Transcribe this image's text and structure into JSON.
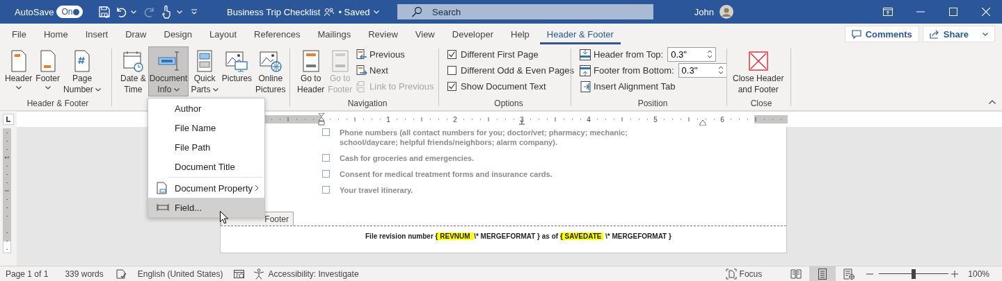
{
  "title_bar": {
    "autosave_label": "AutoSave",
    "autosave": {
      "label": "On",
      "on": true
    },
    "document_title": "Business Trip Checklist",
    "save_status": "• Saved",
    "search": {
      "placeholder": "Search"
    },
    "user_name": "John"
  },
  "tabs": [
    {
      "label": "File",
      "selected": false
    },
    {
      "label": "Home",
      "selected": false
    },
    {
      "label": "Insert",
      "selected": false
    },
    {
      "label": "Draw",
      "selected": false
    },
    {
      "label": "Design",
      "selected": false
    },
    {
      "label": "Layout",
      "selected": false
    },
    {
      "label": "References",
      "selected": false
    },
    {
      "label": "Mailings",
      "selected": false
    },
    {
      "label": "Review",
      "selected": false
    },
    {
      "label": "View",
      "selected": false
    },
    {
      "label": "Developer",
      "selected": false
    },
    {
      "label": "Help",
      "selected": false
    },
    {
      "label": "Header & Footer",
      "selected": true
    }
  ],
  "tab_actions": [
    {
      "kind": "comments",
      "label": "Comments",
      "dropdown": false
    },
    {
      "kind": "share",
      "label": "Share",
      "dropdown": true
    }
  ],
  "ribbon_groups": [
    {
      "label": "Header & Footer",
      "items": [
        {
          "kind": "large",
          "label": "Header",
          "dropdown": true,
          "pressed": false,
          "disabled": false
        },
        {
          "kind": "large",
          "label": "Footer",
          "dropdown": true,
          "pressed": false,
          "disabled": false
        },
        {
          "kind": "large",
          "label": "Page\nNumber",
          "dropdown": true,
          "pressed": false,
          "disabled": false
        }
      ]
    },
    {
      "items": [
        {
          "kind": "large",
          "label": "Date &\nTime",
          "dropdown": false,
          "pressed": false,
          "disabled": false
        },
        {
          "kind": "large",
          "label": "Document\nInfo",
          "dropdown": true,
          "pressed": true,
          "disabled": false
        },
        {
          "kind": "large",
          "label": "Quick\nParts",
          "dropdown": true,
          "pressed": false,
          "disabled": false
        },
        {
          "kind": "large",
          "label": "Pictures",
          "dropdown": false,
          "pressed": false,
          "disabled": false
        },
        {
          "kind": "large",
          "label": "Online\nPictures",
          "dropdown": false,
          "pressed": false,
          "disabled": false
        }
      ]
    },
    {
      "label": "Navigation",
      "items": [
        {
          "kind": "large",
          "label": "Go to\nHeader",
          "dropdown": false,
          "pressed": false,
          "disabled": false
        },
        {
          "kind": "large",
          "label": "Go to\nFooter",
          "dropdown": false,
          "pressed": false,
          "disabled": true
        },
        {
          "kind": "small",
          "label": "Previous",
          "disabled": false
        },
        {
          "kind": "small",
          "label": "Next",
          "disabled": false
        },
        {
          "kind": "small",
          "label": "Link to Previous",
          "disabled": true
        }
      ]
    },
    {
      "label": "Options",
      "items": [
        {
          "kind": "checkbox",
          "label": "Different First Page",
          "checked": true
        },
        {
          "kind": "checkbox",
          "label": "Different Odd & Even Pages",
          "checked": false
        },
        {
          "kind": "checkbox",
          "label": "Show Document Text",
          "checked": true
        }
      ]
    },
    {
      "label": "Position",
      "items": [
        {
          "kind": "spin",
          "label": "Header from Top:",
          "value": "0.3\""
        },
        {
          "kind": "spin",
          "label": "Footer from Bottom:",
          "value": "0.3\""
        },
        {
          "kind": "small",
          "label": "Insert Alignment Tab",
          "disabled": false
        }
      ]
    },
    {
      "label": "Close",
      "items": [
        {
          "kind": "large",
          "label": "Close Header\nand Footer",
          "dropdown": false,
          "pressed": false,
          "disabled": false
        }
      ]
    }
  ],
  "dropdown_menu": {
    "sections": [
      [
        {
          "kind": "text",
          "label": "Author",
          "selected": false
        },
        {
          "kind": "text",
          "label": "File Name",
          "selected": false
        },
        {
          "kind": "text",
          "label": "File Path",
          "selected": false
        },
        {
          "kind": "text",
          "label": "Document Title",
          "selected": false
        }
      ],
      [
        {
          "kind": "property",
          "label": "Document Property",
          "selected": false
        },
        {
          "kind": "field",
          "label": "Field...",
          "selected": true
        }
      ]
    ]
  },
  "ruler": {
    "numbers": [
      "1",
      "2",
      "3",
      "4",
      "5",
      "6"
    ],
    "vertical_numbers": [
      "1"
    ]
  },
  "document": {
    "checklist": [
      {
        "text": "Phone numbers (all contact numbers for you; doctor/vet; pharmacy; mechanic; school/daycare; helpful friends/neighbors; alarm company).",
        "checked": false
      },
      {
        "text": "Cash for groceries and emergencies.",
        "checked": false
      },
      {
        "text": "Consent for medical treatment forms and insurance cards.",
        "checked": false
      },
      {
        "text": "Your travel itinerary.",
        "checked": false
      }
    ],
    "footer_tab": "Footer",
    "footer_text": [
      {
        "text": "File revision number ",
        "highlight": false
      },
      {
        "text": "{ REVNUM  ",
        "highlight": true
      },
      {
        "text": "\\* MERGEFORMAT } as of ",
        "highlight": false
      },
      {
        "text": "{ SAVEDATE ",
        "highlight": true
      },
      {
        "text": " \\* MERGEFORMAT }",
        "highlight": false
      }
    ]
  },
  "status_bar": {
    "page": "Page 1 of 1",
    "words": "339 words",
    "language": "English (United States)",
    "accessibility": "Accessibility: Investigate",
    "focus": "Focus",
    "views": [
      {
        "kind": "read",
        "selected": false
      },
      {
        "kind": "print",
        "selected": true
      },
      {
        "kind": "web",
        "selected": false
      }
    ],
    "zoom": {
      "level": 0.5,
      "reading": "100%"
    }
  }
}
